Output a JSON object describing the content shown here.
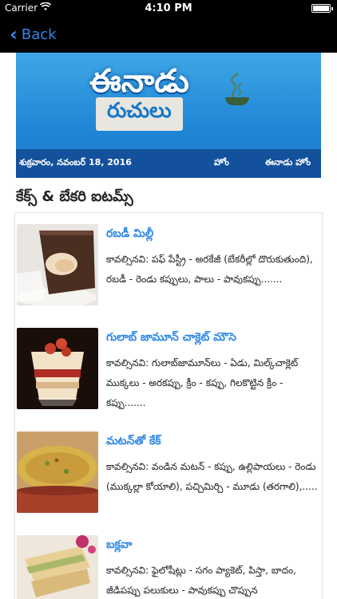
{
  "status_bar": {
    "carrier": "Carrier",
    "time": "4:10 PM"
  },
  "nav": {
    "back_label": "Back"
  },
  "banner": {
    "logo_top": "ఈనాడు",
    "logo_sub": "రుచులు",
    "date": "శుక్రవారం, నవంబర్ 18, 2016",
    "home": "హోం",
    "eenadu_home": "ఈనాడు హోం"
  },
  "section_title": "కేక్స్ & బేకరి ఐటమ్స్",
  "items": [
    {
      "title": "రబడీ మిల్లీ",
      "desc": "కావల్సినవి: పఫ్ పేస్ట్రీ - అరకేజీ (బేకరీల్లో దొరుకుతుంది), రబడీ - రెండు కప్పులు, పాలు - పావుకప్పు......."
    },
    {
      "title": "గులాబ్ జామూన్ చాక్లెట్ మౌసె",
      "desc": "కావల్సినవి: గులాబ్‌జామూన్‌లు - ఏడు, మిల్క్‌చాక్లెట్ ముక్కలు - అరకప్పు, క్రీం - కప్పు, గిలకొట్టిన క్రీం - కప్పు......."
    },
    {
      "title": "మటన్‌తో కేక్",
      "desc": "కావల్సినవి: వండిన మటన్ - కప్పు, ఉల్లిపాయలు - రెండు (ముక్కల్లా కోయాలి), పచ్చిమిర్చి - మూడు (తరగాలి),....."
    },
    {
      "title": "బక్లవా",
      "desc": "కావల్సినవి: ఫైలోషీట్లు - సగం ప్యాకెట్, పిస్తా, బాదం, జీడిపప్పు పలుకులు - పావుకప్పు చొప్పున"
    }
  ]
}
